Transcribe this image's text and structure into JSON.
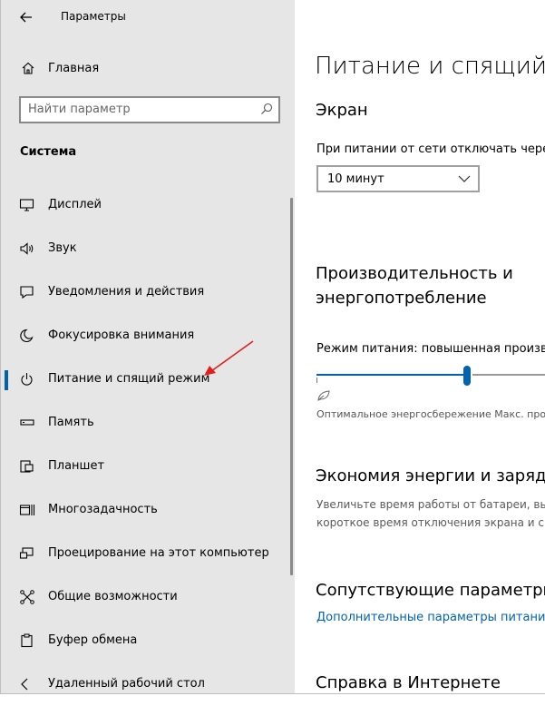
{
  "window": {
    "title": "Параметры"
  },
  "sidebar": {
    "home_label": "Главная",
    "search_placeholder": "Найти параметр",
    "section_title": "Система",
    "items": [
      {
        "label": "Дисплей",
        "icon": "display-icon",
        "selected": false
      },
      {
        "label": "Звук",
        "icon": "speaker-icon",
        "selected": false
      },
      {
        "label": "Уведомления и действия",
        "icon": "notification-icon",
        "selected": false
      },
      {
        "label": "Фокусировка внимания",
        "icon": "moon-icon",
        "selected": false
      },
      {
        "label": "Питание и спящий режим",
        "icon": "power-icon",
        "selected": true
      },
      {
        "label": "Память",
        "icon": "storage-icon",
        "selected": false
      },
      {
        "label": "Планшет",
        "icon": "tablet-icon",
        "selected": false
      },
      {
        "label": "Многозадачность",
        "icon": "multitasking-icon",
        "selected": false
      },
      {
        "label": "Проецирование на этот компьютер",
        "icon": "projecting-icon",
        "selected": false
      },
      {
        "label": "Общие возможности",
        "icon": "shared-experiences-icon",
        "selected": false
      },
      {
        "label": "Буфер обмена",
        "icon": "clipboard-icon",
        "selected": false
      },
      {
        "label": "Удаленный рабочий стол",
        "icon": "remote-desktop-icon",
        "selected": false
      }
    ]
  },
  "main": {
    "page_title": "Питание и спящий режим",
    "screen": {
      "heading": "Экран",
      "on_power_label": "При питании от сети отключать через",
      "on_power_value": "10 минут"
    },
    "performance": {
      "heading": "Производительность и энергопотребление",
      "mode_label": "Режим питания: повышенная производительность",
      "slider_level": 0.6,
      "slider_caption": "Оптимальное энергосбережение Макс. производительность"
    },
    "energy_saving": {
      "heading": "Экономия энергии и заряда",
      "description_line1": "Увеличьте время работы от батареи, выбрав",
      "description_line2": "короткое время отключения экрана и спящего режима"
    },
    "related": {
      "heading": "Сопутствующие параметры",
      "link": "Дополнительные параметры питания"
    },
    "help": {
      "heading": "Справка в Интернете"
    }
  },
  "colors": {
    "accent": "#0063b1",
    "sidebar_bg": "#e6e6e6",
    "annotation_arrow": "#e02020"
  }
}
